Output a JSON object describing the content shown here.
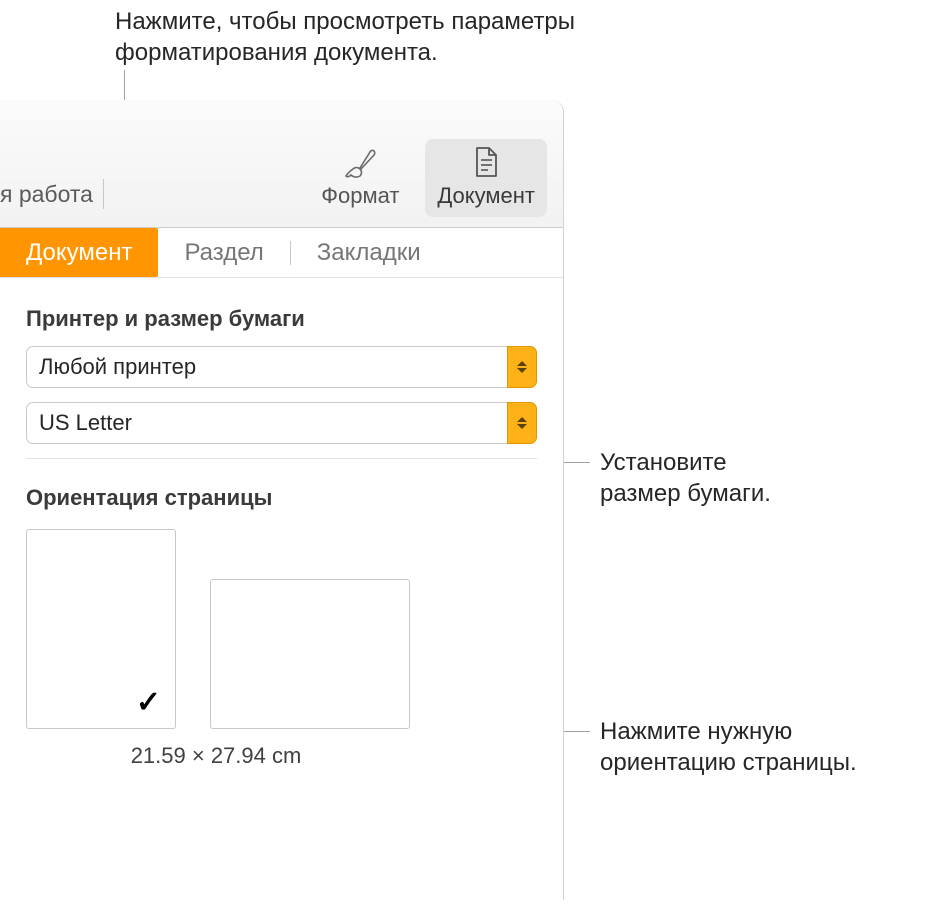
{
  "callouts": {
    "top": "Нажмите, чтобы просмотреть параметры\nформатирования документа.",
    "paper": "Установите\nразмер бумаги.",
    "orient": "Нажмите нужную\nориентацию страницы."
  },
  "toolbar": {
    "left_truncated": "я работа",
    "format_label": "Формат",
    "document_label": "Документ"
  },
  "tabs": {
    "document": "Документ",
    "section": "Раздел",
    "bookmarks": "Закладки"
  },
  "printer_section": {
    "header": "Принтер и размер бумаги",
    "printer_value": "Любой принтер",
    "paper_value": "US Letter"
  },
  "orientation_section": {
    "header": "Ориентация страницы",
    "dimensions": "21.59 × 27.94 cm"
  }
}
